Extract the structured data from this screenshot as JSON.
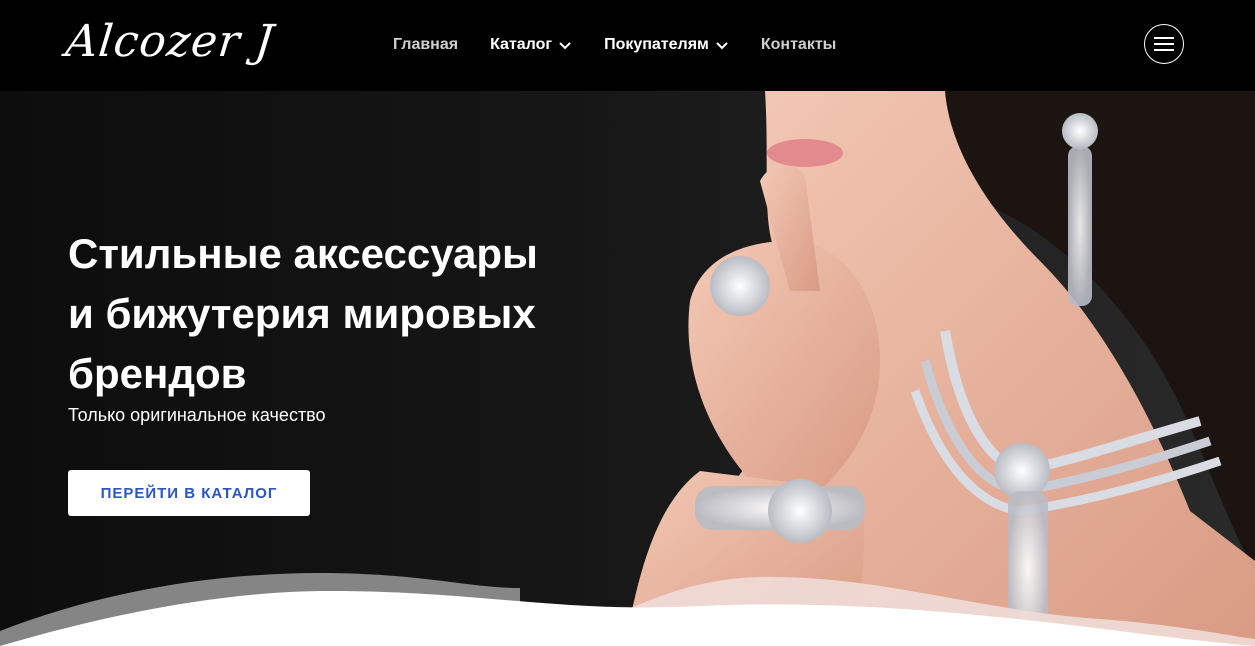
{
  "header": {
    "logo": "Alcozer J",
    "nav": [
      {
        "label": "Главная",
        "has_dropdown": false,
        "color": "#cfcfcf"
      },
      {
        "label": "Каталог",
        "has_dropdown": true,
        "color": "#ffffff"
      },
      {
        "label": "Покупателям",
        "has_dropdown": true,
        "color": "#ffffff"
      },
      {
        "label": "Контакты",
        "has_dropdown": false,
        "color": "#cfcfcf"
      }
    ],
    "menu_icon": "hamburger-icon"
  },
  "hero": {
    "headline_lines": [
      "Стильные аксессуары",
      "и бижутерия мировых",
      "брендов"
    ],
    "subtitle": "Только оригинальное качество",
    "cta_label": "ПЕРЕЙТИ В КАТАЛОГ"
  },
  "colors": {
    "header_bg": "#000000",
    "cta_text": "#2a56c6",
    "cta_bg": "#ffffff",
    "hero_text": "#ffffff"
  }
}
